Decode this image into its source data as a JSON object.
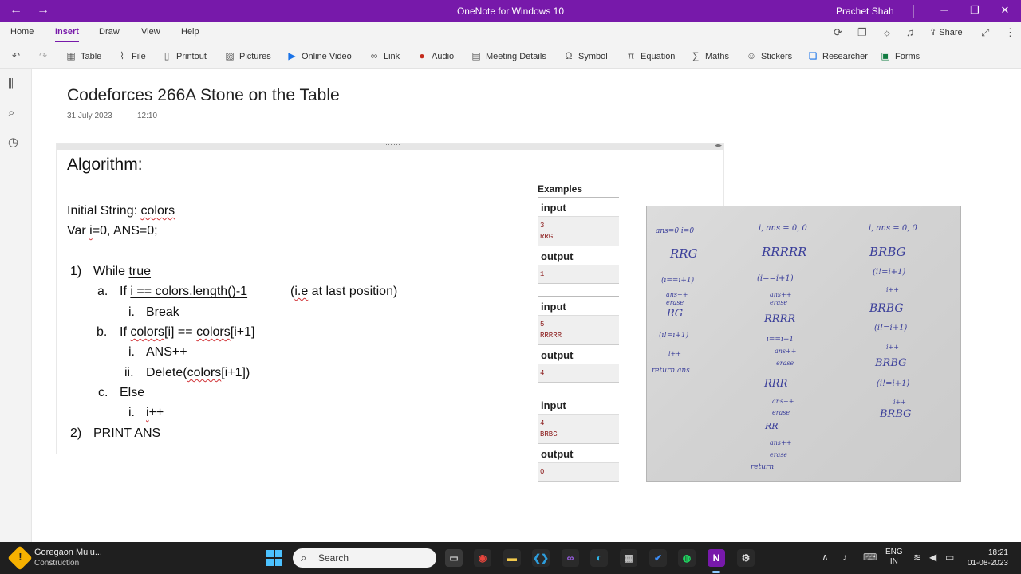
{
  "window": {
    "title": "OneNote for Windows 10",
    "user": "Prachet Shah",
    "minimize": "─",
    "maximize": "❐",
    "close": "✕",
    "back": "←",
    "forward": "→"
  },
  "ribbon": {
    "tabs": [
      "Home",
      "Insert",
      "Draw",
      "View",
      "Help"
    ],
    "active_tab": "Insert",
    "share_label": "Share",
    "tools": [
      {
        "label": "Table",
        "icon": "table-icon"
      },
      {
        "label": "File",
        "icon": "paperclip-icon"
      },
      {
        "label": "Printout",
        "icon": "printout-icon"
      },
      {
        "label": "Pictures",
        "icon": "picture-icon"
      },
      {
        "label": "Online Video",
        "icon": "video-icon"
      },
      {
        "label": "Link",
        "icon": "link-icon"
      },
      {
        "label": "Audio",
        "icon": "audio-icon"
      },
      {
        "label": "Meeting Details",
        "icon": "calendar-icon"
      },
      {
        "label": "Symbol",
        "icon": "omega-icon"
      },
      {
        "label": "Equation",
        "icon": "pi-icon"
      },
      {
        "label": "Maths",
        "icon": "maths-icon"
      },
      {
        "label": "Stickers",
        "icon": "smiley-icon"
      },
      {
        "label": "Researcher",
        "icon": "researcher-icon"
      },
      {
        "label": "Forms",
        "icon": "forms-icon"
      }
    ]
  },
  "page": {
    "title": "Codeforces 266A Stone on the Table",
    "date": "31 July 2023",
    "time": "12:10"
  },
  "algorithm": {
    "heading": "Algorithm:",
    "init1_pre": "Initial String: ",
    "init1_word": "colors",
    "init2_pre": "Var ",
    "init2_var": "i",
    "init2_post": "=0, ANS=0;",
    "s1_num": "1)",
    "s1_pre": "While ",
    "s1_word": "true",
    "a_num": "a.",
    "a_pre": "If ",
    "a_cond": "i == colors.length()-1",
    "a_note_pre": "(",
    "a_note_word": "i.e",
    "a_note_post": " at last position)",
    "a_i_num": "i.",
    "a_i_text": "Break",
    "b_num": "b.",
    "b_pre": "If ",
    "b_w1": "colors",
    "b_mid": "[i] == ",
    "b_w2": "colors",
    "b_post": "[i+1]",
    "b_i_num": "i.",
    "b_i_text": "ANS++",
    "b_ii_num": "ii.",
    "b_ii_pre": "Delete(",
    "b_ii_word": "colors",
    "b_ii_post": "[i+1])",
    "c_num": "c.",
    "c_text": "Else",
    "c_i_num": "i.",
    "c_i_word": "i",
    "c_i_post": "++",
    "s2_num": "2)",
    "s2_text": "PRINT ANS"
  },
  "examples": {
    "heading": "Examples",
    "input_label": "input",
    "output_label": "output",
    "cases": [
      {
        "n": "3",
        "s": "RRG",
        "out": "1"
      },
      {
        "n": "5",
        "s": "RRRRR",
        "out": "4"
      },
      {
        "n": "4",
        "s": "BRBG",
        "out": "0"
      }
    ]
  },
  "handwriting": {
    "col1": [
      "ans=0 i=0",
      "RRG",
      "(i==i+1)",
      "ans++",
      "erase",
      "RG",
      "(i!=i+1)",
      "i++",
      "return ans"
    ],
    "col2": [
      "i, ans = 0, 0",
      "RRRRR",
      "(i==i+1)",
      "ans++",
      "erase",
      "RRRR",
      "i==i+1",
      "ans++",
      "erase",
      "RRR",
      "ans++",
      "erase",
      "RR",
      "ans++",
      "erase",
      "return"
    ],
    "col3": [
      "i, ans = 0, 0",
      "BRBG",
      "(i!=i+1)",
      "i++",
      "BRBG",
      "(i!=i+1)",
      "i++",
      "BRBG",
      "(i!=i+1)",
      "i++",
      "BRBG"
    ]
  },
  "taskbar": {
    "weather_title": "Goregaon Mulu...",
    "weather_sub": "Construction",
    "search_placeholder": "Search",
    "lang1": "ENG",
    "lang2": "IN",
    "time": "18:21",
    "date": "01-08-2023"
  }
}
